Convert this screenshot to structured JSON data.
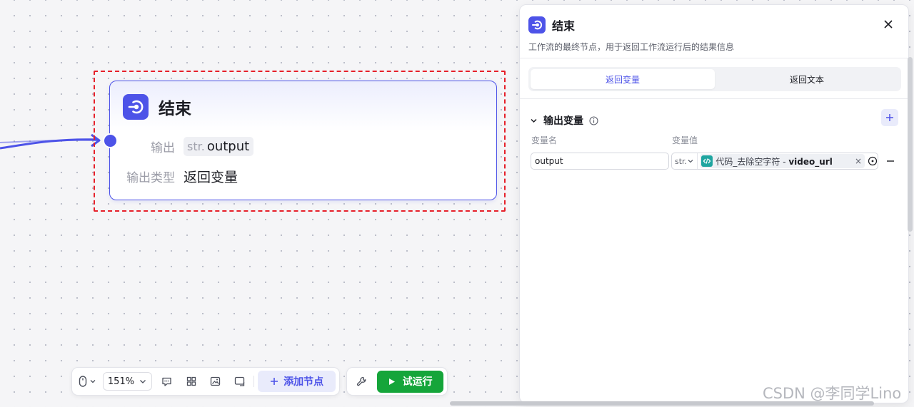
{
  "node": {
    "title": "结束",
    "output_label": "输出",
    "output_type_tag": "str.",
    "output_name": "output",
    "output_type_label": "输出类型",
    "output_type_value": "返回变量",
    "icon": "end-node-icon",
    "accent": "#4d53e8"
  },
  "toolbar": {
    "zoom": "151%",
    "add_node": "添加节点",
    "run": "试运行",
    "run_color": "#15a53a"
  },
  "panel": {
    "title": "结束",
    "description": "工作流的最终节点，用于返回工作流运行后的结果信息",
    "tabs": [
      {
        "label": "返回变量",
        "active": true
      },
      {
        "label": "返回文本",
        "active": false
      }
    ],
    "section_title": "输出变量",
    "col_name": "变量名",
    "col_value": "变量值",
    "row": {
      "name": "output",
      "type": "str.",
      "ref_source": "代码_去除空字符",
      "ref_sep": " - ",
      "ref_var": "video_url",
      "clear": "×"
    }
  },
  "watermark": "CSDN @李同学Lino"
}
